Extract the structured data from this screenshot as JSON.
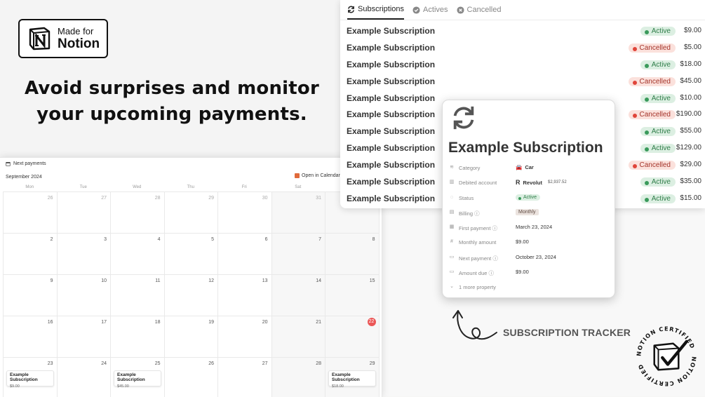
{
  "badge": {
    "line1": "Made for",
    "line2": "Notion"
  },
  "headline": "Avoid surprises and monitor your upcoming payments.",
  "calendar": {
    "title": "Next payments",
    "month": "September 2024",
    "open_label": "Open in Calendar",
    "weekdays": [
      "Mon",
      "Tue",
      "Wed",
      "Thu",
      "Fri",
      "Sat",
      "Sun"
    ],
    "days": [
      {
        "n": "26",
        "muted": true
      },
      {
        "n": "27",
        "muted": true
      },
      {
        "n": "28",
        "muted": true
      },
      {
        "n": "29",
        "muted": true
      },
      {
        "n": "30",
        "muted": true
      },
      {
        "n": "31",
        "muted": true
      },
      {
        "n": "1"
      },
      {
        "n": "2"
      },
      {
        "n": "3"
      },
      {
        "n": "4"
      },
      {
        "n": "5"
      },
      {
        "n": "6"
      },
      {
        "n": "7"
      },
      {
        "n": "8"
      },
      {
        "n": "9"
      },
      {
        "n": "10"
      },
      {
        "n": "11"
      },
      {
        "n": "12"
      },
      {
        "n": "13"
      },
      {
        "n": "14"
      },
      {
        "n": "15"
      },
      {
        "n": "16"
      },
      {
        "n": "17"
      },
      {
        "n": "18"
      },
      {
        "n": "19"
      },
      {
        "n": "20"
      },
      {
        "n": "21"
      },
      {
        "n": "22",
        "today": true
      },
      {
        "n": "23",
        "event": {
          "title": "Example Subscription",
          "amount": "$9.00"
        }
      },
      {
        "n": "24"
      },
      {
        "n": "25",
        "event": {
          "title": "Example Subscription",
          "amount": "$45.00"
        }
      },
      {
        "n": "26"
      },
      {
        "n": "27"
      },
      {
        "n": "28"
      },
      {
        "n": "29",
        "event": {
          "title": "Example Subscription",
          "amount": "$18.00"
        }
      }
    ]
  },
  "tabs": [
    {
      "label": "Subscriptions",
      "icon": "refresh-icon",
      "active": true
    },
    {
      "label": "Actives",
      "icon": "check-circle-icon",
      "active": false
    },
    {
      "label": "Cancelled",
      "icon": "x-circle-icon",
      "active": false
    }
  ],
  "subscriptions": [
    {
      "name": "Example Subscription",
      "status": "Active",
      "price": "$9.00"
    },
    {
      "name": "Example Subscription",
      "status": "Cancelled",
      "price": "$5.00"
    },
    {
      "name": "Example Subscription",
      "status": "Active",
      "price": "$18.00"
    },
    {
      "name": "Example Subscription",
      "status": "Cancelled",
      "price": "$45.00"
    },
    {
      "name": "Example Subscription",
      "status": "Active",
      "price": "$10.00"
    },
    {
      "name": "Example Subscription",
      "status": "Cancelled",
      "price": "$190.00"
    },
    {
      "name": "Example Subscription",
      "status": "Active",
      "price": "$55.00"
    },
    {
      "name": "Example Subscription",
      "status": "Active",
      "price": "$129.00"
    },
    {
      "name": "Example Subscription",
      "status": "Cancelled",
      "price": "$29.00"
    },
    {
      "name": "Example Subscription",
      "status": "Active",
      "price": "$35.00"
    },
    {
      "name": "Example Subscription",
      "status": "Active",
      "price": "$15.00"
    }
  ],
  "card": {
    "title": "Example Subscription",
    "category_label": "Category",
    "category_value": "Car",
    "account_label": "Debited account",
    "account_value": "Revolut",
    "account_balance": "$2,937.52",
    "status_label": "Status",
    "status_value": "Active",
    "billing_label": "Billing",
    "billing_value": "Monthly",
    "first_payment_label": "First payment",
    "first_payment_value": "March 23, 2024",
    "monthly_amount_label": "Monthly amount",
    "monthly_amount_value": "$9.00",
    "next_payment_label": "Next payment",
    "next_payment_value": "October 23, 2024",
    "amount_due_label": "Amount due",
    "amount_due_value": "$9.00",
    "more_label": "1 more property"
  },
  "tracker_label": "SUBSCRIPTION TRACKER",
  "seal": {
    "text": "NOTION CERTIFIED"
  },
  "colors": {
    "active_bg": "#dcefe2",
    "cancelled_bg": "#fbe1dc",
    "today": "#eb5757"
  }
}
